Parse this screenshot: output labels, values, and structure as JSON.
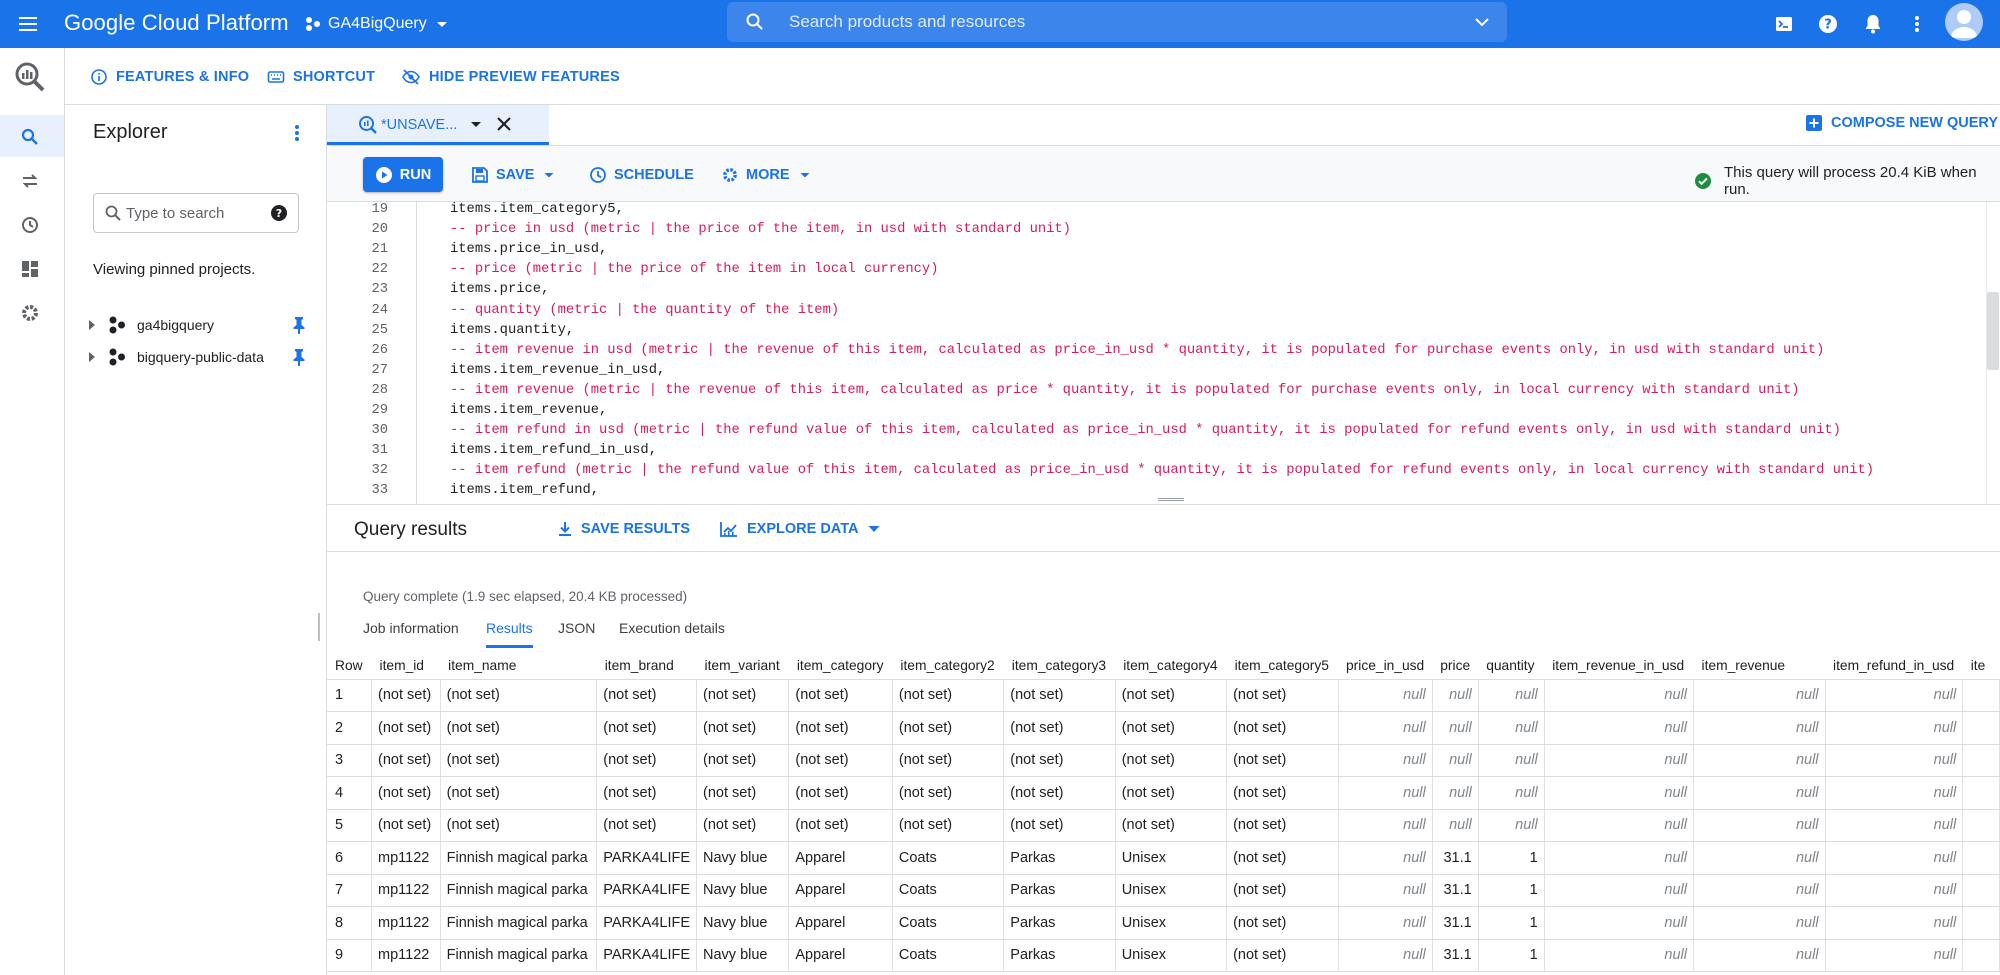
{
  "topbar": {
    "brand": "Google Cloud Platform",
    "project": "GA4BigQuery",
    "search_placeholder": "Search products and resources"
  },
  "toolbar": {
    "features": "FEATURES & INFO",
    "shortcut": "SHORTCUT",
    "hide_preview": "HIDE PREVIEW FEATURES"
  },
  "explorer": {
    "title": "Explorer",
    "search_placeholder": "Type to search",
    "pinned_text": "Viewing pinned projects.",
    "projects": [
      "ga4bigquery",
      "bigquery-public-data"
    ]
  },
  "editor": {
    "tab_label": "*UNSAVE...",
    "compose": "COMPOSE NEW QUERY",
    "run": "RUN",
    "save": "SAVE",
    "schedule": "SCHEDULE",
    "more": "MORE",
    "status": "This query will process 20.4 KiB when run.",
    "lines": [
      {
        "n": "19",
        "t": "items.item_category5,",
        "kind": "code"
      },
      {
        "n": "20",
        "t": "-- price in usd (metric | the price of the item, in usd with standard unit)",
        "kind": "comment"
      },
      {
        "n": "21",
        "t": "items.price_in_usd,",
        "kind": "code"
      },
      {
        "n": "22",
        "t": "-- price (metric | the price of the item in local currency)",
        "kind": "comment"
      },
      {
        "n": "23",
        "t": "items.price,",
        "kind": "code"
      },
      {
        "n": "24",
        "t": "-- quantity (metric | the quantity of the item)",
        "kind": "comment"
      },
      {
        "n": "25",
        "t": "items.quantity,",
        "kind": "code"
      },
      {
        "n": "26",
        "t": "-- item revenue in usd (metric | the revenue of this item, calculated as price_in_usd * quantity, it is populated for purchase events only, in usd with standard unit)",
        "kind": "comment"
      },
      {
        "n": "27",
        "t": "items.item_revenue_in_usd,",
        "kind": "code"
      },
      {
        "n": "28",
        "t": "-- item revenue (metric | the revenue of this item, calculated as price * quantity, it is populated for purchase events only, in local currency with standard unit)",
        "kind": "comment"
      },
      {
        "n": "29",
        "t": "items.item_revenue,",
        "kind": "code"
      },
      {
        "n": "30",
        "t": "-- item refund in usd (metric | the refund value of this item, calculated as price_in_usd * quantity, it is populated for refund events only, in usd with standard unit)",
        "kind": "comment"
      },
      {
        "n": "31",
        "t": "items.item_refund_in_usd,",
        "kind": "code"
      },
      {
        "n": "32",
        "t": "-- item refund (metric | the refund value of this item, calculated as price_in_usd * quantity, it is populated for refund events only, in local currency with standard unit)",
        "kind": "comment"
      },
      {
        "n": "33",
        "t": "items.item_refund,",
        "kind": "code"
      }
    ]
  },
  "results": {
    "title": "Query results",
    "save_results": "SAVE RESULTS",
    "explore_data": "EXPLORE DATA",
    "query_status": "Query complete (1.9 sec elapsed, 20.4 KB processed)",
    "tabs": [
      "Job information",
      "Results",
      "JSON",
      "Execution details"
    ],
    "active_tab": "Results",
    "columns": [
      "Row",
      "item_id",
      "item_name",
      "item_brand",
      "item_variant",
      "item_category",
      "item_category2",
      "item_category3",
      "item_category4",
      "item_category5",
      "price_in_usd",
      "price",
      "quantity",
      "item_revenue_in_usd",
      "item_revenue",
      "item_refund_in_usd",
      "ite"
    ],
    "rows": [
      [
        "1",
        "(not set)",
        "(not set)",
        "(not set)",
        "(not set)",
        "(not set)",
        "(not set)",
        "(not set)",
        "(not set)",
        "(not set)",
        "null",
        "null",
        "null",
        "null",
        "null",
        "null",
        ""
      ],
      [
        "2",
        "(not set)",
        "(not set)",
        "(not set)",
        "(not set)",
        "(not set)",
        "(not set)",
        "(not set)",
        "(not set)",
        "(not set)",
        "null",
        "null",
        "null",
        "null",
        "null",
        "null",
        ""
      ],
      [
        "3",
        "(not set)",
        "(not set)",
        "(not set)",
        "(not set)",
        "(not set)",
        "(not set)",
        "(not set)",
        "(not set)",
        "(not set)",
        "null",
        "null",
        "null",
        "null",
        "null",
        "null",
        ""
      ],
      [
        "4",
        "(not set)",
        "(not set)",
        "(not set)",
        "(not set)",
        "(not set)",
        "(not set)",
        "(not set)",
        "(not set)",
        "(not set)",
        "null",
        "null",
        "null",
        "null",
        "null",
        "null",
        ""
      ],
      [
        "5",
        "(not set)",
        "(not set)",
        "(not set)",
        "(not set)",
        "(not set)",
        "(not set)",
        "(not set)",
        "(not set)",
        "(not set)",
        "null",
        "null",
        "null",
        "null",
        "null",
        "null",
        ""
      ],
      [
        "6",
        "mp1122",
        "Finnish magical parka",
        "PARKA4LIFE",
        "Navy blue",
        "Apparel",
        "Coats",
        "Parkas",
        "Unisex",
        "(not set)",
        "null",
        "31.1",
        "1",
        "null",
        "null",
        "null",
        ""
      ],
      [
        "7",
        "mp1122",
        "Finnish magical parka",
        "PARKA4LIFE",
        "Navy blue",
        "Apparel",
        "Coats",
        "Parkas",
        "Unisex",
        "(not set)",
        "null",
        "31.1",
        "1",
        "null",
        "null",
        "null",
        ""
      ],
      [
        "8",
        "mp1122",
        "Finnish magical parka",
        "PARKA4LIFE",
        "Navy blue",
        "Apparel",
        "Coats",
        "Parkas",
        "Unisex",
        "(not set)",
        "null",
        "31.1",
        "1",
        "null",
        "null",
        "null",
        ""
      ],
      [
        "9",
        "mp1122",
        "Finnish magical parka",
        "PARKA4LIFE",
        "Navy blue",
        "Apparel",
        "Coats",
        "Parkas",
        "Unisex",
        "(not set)",
        "null",
        "31.1",
        "1",
        "null",
        "null",
        "null",
        ""
      ]
    ]
  },
  "colors": {
    "accent": "#1a73e8",
    "comment": "#d81b60",
    "success": "#1e8e3e"
  }
}
